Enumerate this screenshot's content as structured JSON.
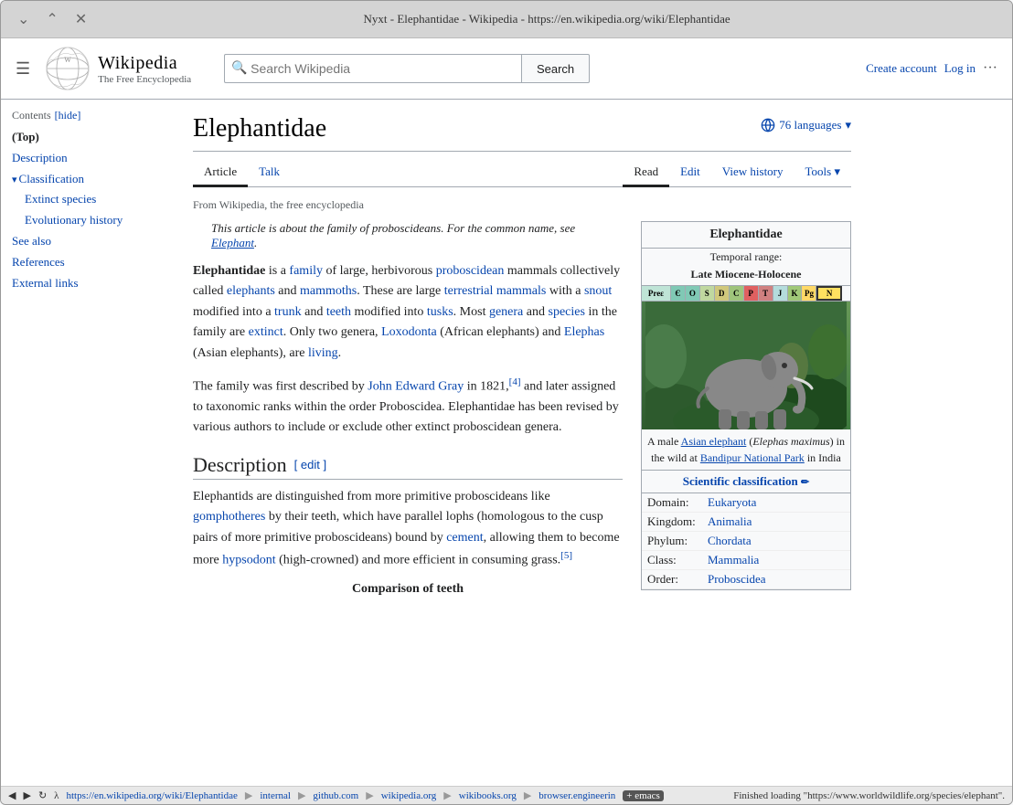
{
  "browser": {
    "title": "Nyxt - Elephantidae - Wikipedia - https://en.wikipedia.org/wiki/Elephantidae",
    "url": "https://en.wikipedia.org/wiki/Elephantidae",
    "status_msg": "Finished loading \"https://www.worldwildlife.org/species/elephant\".",
    "breadcrumbs": [
      "internal",
      "github.com",
      "wikipedia.org",
      "wikibooks.org",
      "browser.engineerin"
    ],
    "breadcrumb_plus": "+ emacs"
  },
  "wiki": {
    "logo_title": "Wikipedia",
    "logo_subtitle": "The Free Encyclopedia",
    "search_placeholder": "Search Wikipedia",
    "search_btn": "Search",
    "create_account": "Create account",
    "log_in": "Log in",
    "more_icon": "···"
  },
  "sidebar": {
    "toc_label": "Contents",
    "hide_label": "[hide]",
    "items": [
      {
        "label": "(Top)",
        "active": true,
        "sub": false
      },
      {
        "label": "Description",
        "active": false,
        "sub": false
      },
      {
        "label": "Classification",
        "active": false,
        "sub": false,
        "expandable": true
      },
      {
        "label": "Extinct species",
        "active": false,
        "sub": true
      },
      {
        "label": "Evolutionary history",
        "active": false,
        "sub": true
      },
      {
        "label": "See also",
        "active": false,
        "sub": false
      },
      {
        "label": "References",
        "active": false,
        "sub": false
      },
      {
        "label": "External links",
        "active": false,
        "sub": false
      }
    ]
  },
  "article": {
    "title": "Elephantidae",
    "lang_btn": "76 languages",
    "tabs": {
      "article": "Article",
      "talk": "Talk",
      "read": "Read",
      "edit": "Edit",
      "view_history": "View history",
      "tools": "Tools"
    },
    "from_wiki": "From Wikipedia, the free encyclopedia",
    "italic_note": "This article is about the family of proboscideans. For the common name, see",
    "italic_note_link": "Elephant",
    "italic_note_end": ".",
    "body_p1": "Elephantidae is a family of large, herbivorous proboscidean mammals collectively called elephants and mammoths. These are large terrestrial mammals with a snout modified into a trunk and teeth modified into tusks. Most genera and species in the family are extinct. Only two genera, Loxodonta (African elephants) and Elephas (Asian elephants), are living.",
    "body_p2_parts": [
      "The family was first described by ",
      "John Edward Gray",
      " in 1821,",
      "[4]",
      " and later assigned to taxonomic ranks within the order Proboscidea. Elephantidae has been revised by various authors to include or exclude other extinct proboscidean genera."
    ],
    "desc_title": "Description",
    "desc_edit": "[ edit ]",
    "desc_p1": "Elephantids are distinguished from more primitive proboscideans like gomphotheres by their teeth, which have parallel lophs (homologous to the cusp pairs of more primitive proboscideans) bound by cement, allowing them to become more hypsodont (high-crowned) and more efficient in consuming grass.",
    "desc_ref": "[5]",
    "compare_title": "Comparison of teeth"
  },
  "infobox": {
    "title": "Elephantidae",
    "temporal_range_label": "Temporal range:",
    "temporal_range_value": "Late Miocene-Holocene",
    "timescale": [
      {
        "label": "Preɛ",
        "color": "#bfe4d6",
        "width": 14
      },
      {
        "label": "Є",
        "color": "#80c9b5",
        "width": 7
      },
      {
        "label": "O",
        "color": "#80c9b5",
        "width": 7
      },
      {
        "label": "S",
        "color": "#c0d8a0",
        "width": 7
      },
      {
        "label": "D",
        "color": "#d0c87c",
        "width": 7
      },
      {
        "label": "C",
        "color": "#9fc47c",
        "width": 7
      },
      {
        "label": "P",
        "color": "#e06060",
        "width": 7
      },
      {
        "label": "T",
        "color": "#d08080",
        "width": 7
      },
      {
        "label": "J",
        "color": "#b4dcdc",
        "width": 7
      },
      {
        "label": "K",
        "color": "#a0c878",
        "width": 7
      },
      {
        "label": "Pg",
        "color": "#fd9",
        "width": 7
      },
      {
        "label": "N",
        "color": "#fee060",
        "width": 12,
        "highlight": true
      }
    ],
    "caption": "A male Asian elephant (Elephas maximus) in the wild at Bandipur National Park in India",
    "sci_class_label": "Scientific classification",
    "sci_class_edit_icon": "✏",
    "rows": [
      {
        "label": "Domain:",
        "value": "Eukaryota"
      },
      {
        "label": "Kingdom:",
        "value": "Animalia"
      },
      {
        "label": "Phylum:",
        "value": "Chordata"
      },
      {
        "label": "Class:",
        "value": "Mammalia"
      },
      {
        "label": "Order:",
        "value": "Proboscidea"
      }
    ]
  }
}
